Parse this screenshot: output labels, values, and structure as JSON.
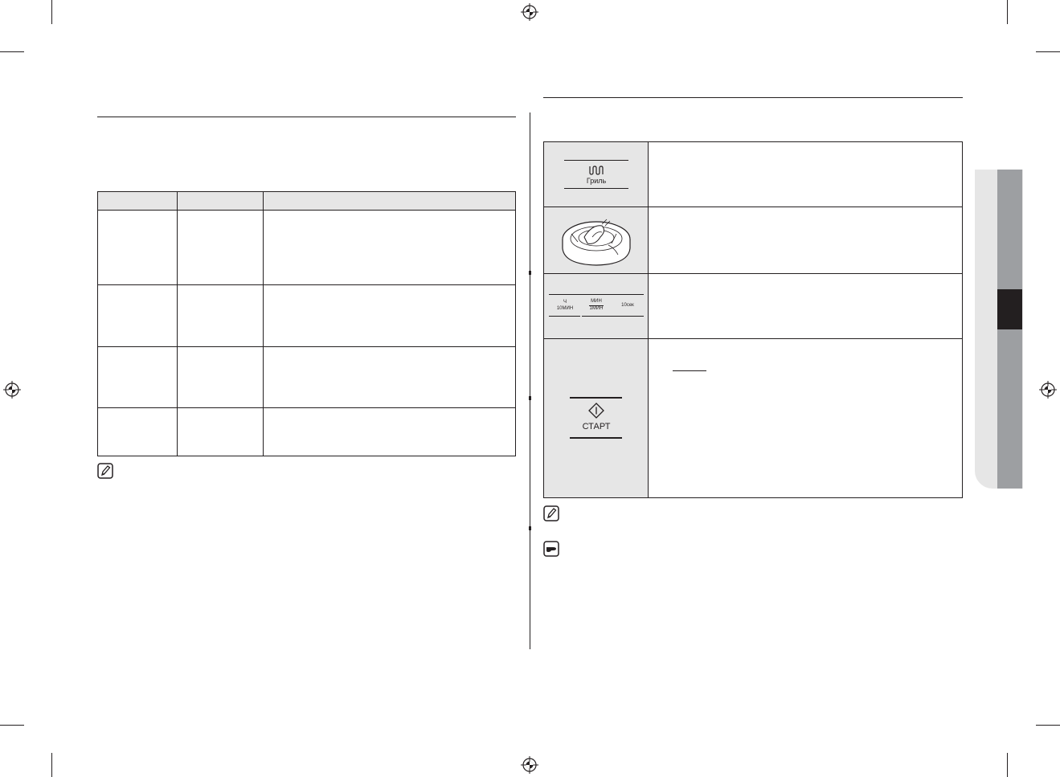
{
  "controls": {
    "grill_key_label": "Гриль",
    "time_key_hour": "Ч",
    "time_key_10min": "10МИН",
    "time_key_min": "МИН",
    "time_key_1min": "1МИН",
    "time_key_10sec": "10сек",
    "start_key_label": "СТАРТ"
  },
  "icons": {
    "grill_symbol": "grill-wave-icon",
    "dial": "dial-knob-icon",
    "start_symbol": "start-diamond-icon",
    "note_left": "note-pencil-icon",
    "note_right": "note-pencil-icon",
    "caution": "pointing-hand-icon"
  },
  "colors": {
    "ink": "#231f20",
    "cell_fill": "#e6e6e6",
    "tab_gray": "#9d9fa2"
  }
}
